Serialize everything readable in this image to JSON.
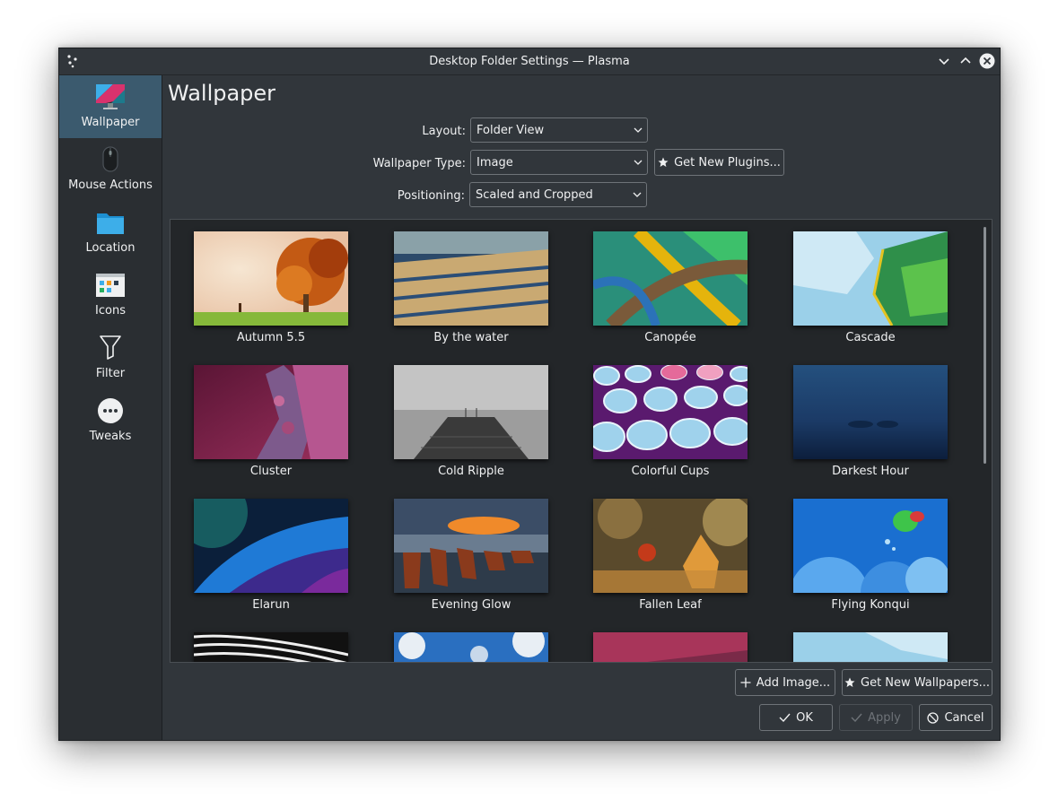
{
  "window": {
    "title": "Desktop Folder Settings — Plasma"
  },
  "sidebar": {
    "items": [
      {
        "label": "Wallpaper",
        "icon": "monitor-icon",
        "active": true
      },
      {
        "label": "Mouse Actions",
        "icon": "mouse-icon",
        "active": false
      },
      {
        "label": "Location",
        "icon": "folder-icon",
        "active": false
      },
      {
        "label": "Icons",
        "icon": "icons-view-icon",
        "active": false
      },
      {
        "label": "Filter",
        "icon": "filter-icon",
        "active": false
      },
      {
        "label": "Tweaks",
        "icon": "more-icon",
        "active": false
      }
    ]
  },
  "page": {
    "title": "Wallpaper"
  },
  "form": {
    "layout": {
      "label": "Layout:",
      "value": "Folder View"
    },
    "wallpaper_type": {
      "label": "Wallpaper Type:",
      "value": "Image"
    },
    "positioning": {
      "label": "Positioning:",
      "value": "Scaled and Cropped"
    },
    "get_plugins": "Get New Plugins..."
  },
  "wallpapers": [
    "Autumn 5.5",
    "By the water",
    "Canopée",
    "Cascade",
    "Cluster",
    "Cold Ripple",
    "Colorful Cups",
    "Darkest Hour",
    "Elarun",
    "Evening Glow",
    "Fallen Leaf",
    "Flying Konqui"
  ],
  "actions": {
    "add_image": "Add Image...",
    "get_wallpapers": "Get New Wallpapers...",
    "ok": "OK",
    "apply": "Apply",
    "cancel": "Cancel"
  },
  "colors": {
    "window_bg": "#31363b",
    "sidebar_bg": "#2a2e32",
    "selection": "#3b5a6e",
    "text": "#eff0f1"
  }
}
